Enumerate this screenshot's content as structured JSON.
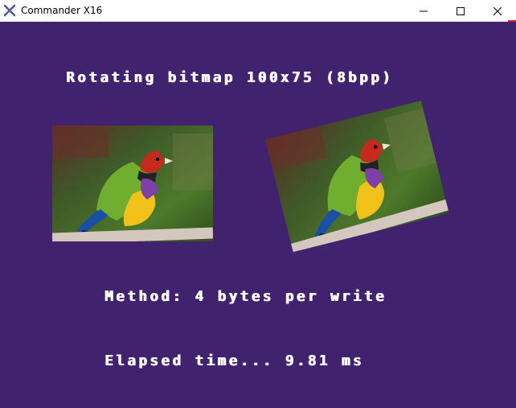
{
  "window": {
    "title": "Commander X16",
    "icons": {
      "app": "commander-x16-icon",
      "minimize": "minimize-icon",
      "maximize": "maximize-icon",
      "close": "close-icon"
    }
  },
  "screen": {
    "background": "#40226f",
    "heading": "Rotating bitmap 100x75 (8bpp)",
    "method": "Method: 4 bytes per write",
    "elapsed": "Elapsed time... 9.81 ms",
    "images": {
      "original": "gouldian-finch-bitmap",
      "rotated": "gouldian-finch-bitmap-rotated"
    }
  }
}
